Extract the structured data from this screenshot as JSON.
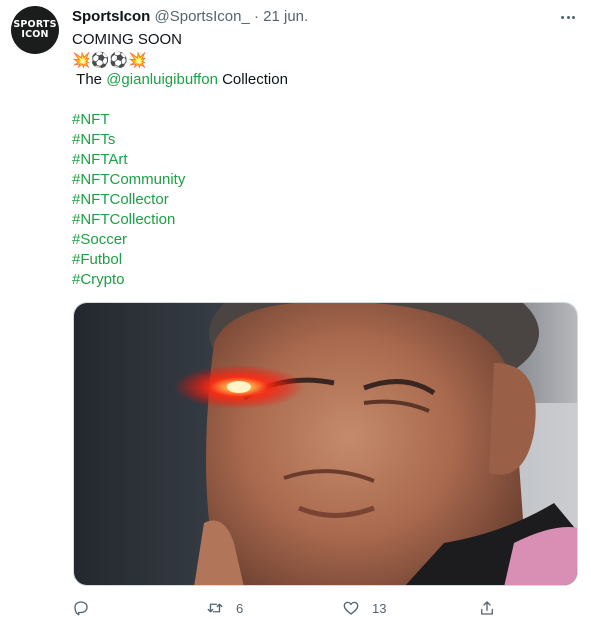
{
  "tweet": {
    "avatar": {
      "line1": "SPORTS",
      "line2": "ICON"
    },
    "author_name": "SportsIcon",
    "handle": "@SportsIcon_",
    "separator": "·",
    "date": "21 jun.",
    "text": {
      "headline": "COMING SOON",
      "emoji_row": "💥⚽⚽💥",
      "collection_prefix": "The",
      "mention": "@gianluigibuffon",
      "collection_suffix": "Collection",
      "hashtags": [
        "#NFT",
        "#NFTs",
        "#NFTArt",
        "#NFTCommunity",
        "#NFTCollector",
        "#NFTCollection",
        "#Soccer",
        "#Futbol",
        "#Crypto"
      ]
    },
    "actions": {
      "reply": {
        "icon": "reply-icon",
        "count": ""
      },
      "retweet": {
        "icon": "retweet-icon",
        "count": "6"
      },
      "like": {
        "icon": "heart-icon",
        "count": "13"
      },
      "share": {
        "icon": "share-icon",
        "count": ""
      }
    },
    "colors": {
      "link": "#1da046",
      "secondary": "#536471",
      "laser": "#ff2a10"
    }
  }
}
